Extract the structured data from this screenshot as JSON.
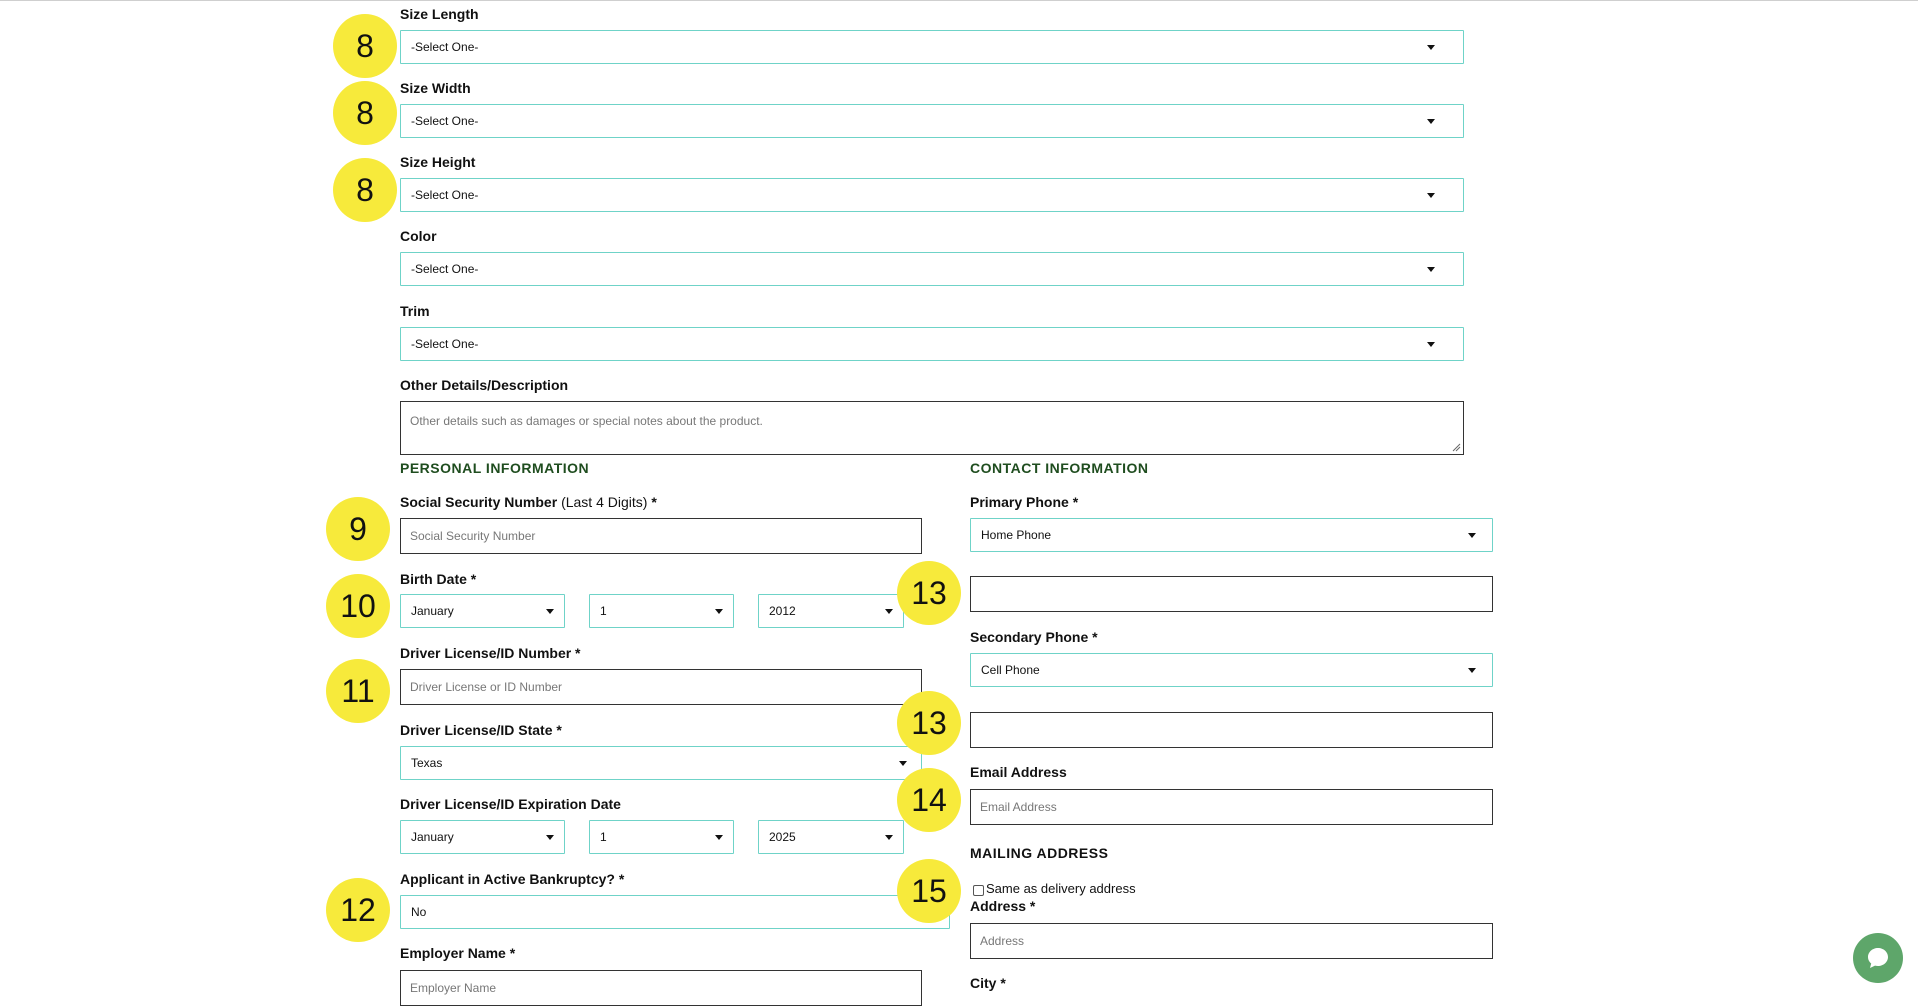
{
  "product": {
    "size_length": {
      "label": "Size Length",
      "value": "-Select One-"
    },
    "size_width": {
      "label": "Size Width",
      "value": "-Select One-"
    },
    "size_height": {
      "label": "Size Height",
      "value": "-Select One-"
    },
    "color": {
      "label": "Color",
      "value": "-Select One-"
    },
    "trim": {
      "label": "Trim",
      "value": "-Select One-"
    },
    "other_details": {
      "label": "Other Details/Description",
      "placeholder": "Other details such as damages or special notes about the product."
    }
  },
  "personal": {
    "heading": "PERSONAL INFORMATION",
    "ssn": {
      "label": "Social Security Number",
      "note": "(Last 4 Digits)",
      "required": "*",
      "placeholder": "Social Security Number"
    },
    "birth_date": {
      "label": "Birth Date *",
      "month": "January",
      "day": "1",
      "year": "2012"
    },
    "dl_number": {
      "label": "Driver License/ID Number *",
      "placeholder": "Driver License or ID Number"
    },
    "dl_state": {
      "label": "Driver License/ID State *",
      "value": "Texas"
    },
    "dl_expiration": {
      "label": "Driver License/ID Expiration Date",
      "month": "January",
      "day": "1",
      "year": "2025"
    },
    "bankruptcy": {
      "label": "Applicant in Active Bankruptcy? *",
      "value": "No"
    },
    "employer": {
      "label": "Employer Name *",
      "placeholder": "Employer Name"
    }
  },
  "contact": {
    "heading": "CONTACT INFORMATION",
    "primary_phone": {
      "label": "Primary Phone *",
      "type": "Home Phone",
      "value": ""
    },
    "secondary_phone": {
      "label": "Secondary Phone *",
      "type": "Cell Phone",
      "value": ""
    },
    "email": {
      "label": "Email Address",
      "placeholder": "Email Address"
    }
  },
  "mailing": {
    "heading": "MAILING ADDRESS",
    "same_as_delivery": "Same as delivery address",
    "address": {
      "label": "Address *",
      "placeholder": "Address"
    },
    "city": {
      "label": "City *"
    }
  },
  "annotations": {
    "size_length": "8",
    "size_width": "8",
    "size_height": "8",
    "ssn": "9",
    "birth_date": "10",
    "dl_number": "11",
    "bankruptcy": "12",
    "primary_phone": "13",
    "secondary_phone": "13",
    "email": "14",
    "mailing_checkbox": "15"
  },
  "colors": {
    "select_border": "#6fd3c8",
    "section_heading": "#1f4d1f",
    "annotation": "#f7ea3b",
    "chat_button": "#5ea66a"
  },
  "icons": {
    "chat": "chat-bubble-icon",
    "dropdown": "chevron-down-icon"
  }
}
